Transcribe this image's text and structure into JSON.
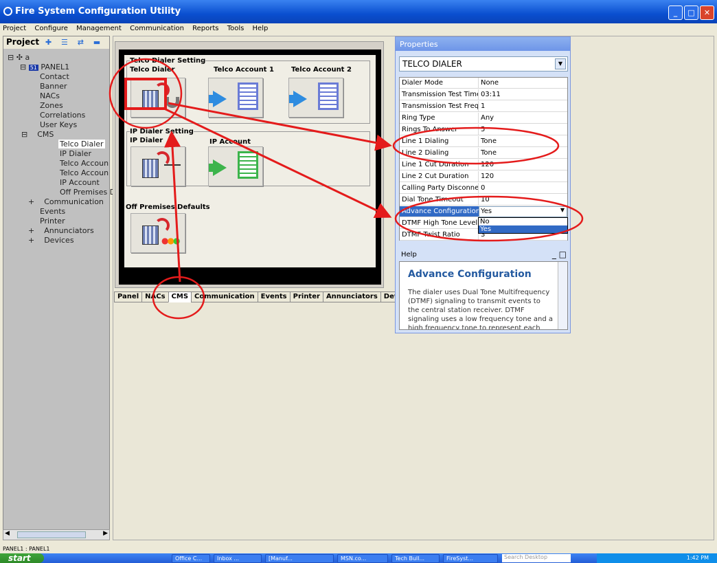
{
  "window": {
    "title": "Fire System Configuration Utility"
  },
  "menu": [
    "Project",
    "Configure",
    "Management",
    "Communication",
    "Reports",
    "Tools",
    "Help"
  ],
  "project": {
    "title": "Project",
    "tree": [
      "a",
      "PANEL1",
      "Contact",
      "Banner",
      "NACs",
      "Zones",
      "Correlations",
      "User Keys",
      "CMS",
      "Telco Dialer",
      "IP Dialer",
      "Telco Accoun",
      "Telco Accoun",
      "IP Account",
      "Off Premises D",
      "Communication",
      "Events",
      "Printer",
      "Annunciators",
      "Devices"
    ],
    "panel_badge": "51"
  },
  "cms": {
    "telco_group": "Telco Dialer Setting",
    "telco_dialer": "Telco Dialer",
    "telco_account1": "Telco Account 1",
    "telco_account2": "Telco Account 2",
    "ip_group": "IP Dialer Setting",
    "ip_dialer": "IP Dialer",
    "ip_account": "IP Account",
    "off_premises": "Off Premises Defaults"
  },
  "tabs": [
    "Panel",
    "NACs",
    "CMS",
    "Communication",
    "Events",
    "Printer",
    "Annunciators",
    "Devices"
  ],
  "properties": {
    "title": "Properties",
    "selected_object": "TELCO DIALER",
    "rows": [
      {
        "name": "Dialer Mode",
        "value": "None"
      },
      {
        "name": "Transmission Test Time",
        "value": "03:11"
      },
      {
        "name": "Transmission Test Frequenc",
        "value": "1"
      },
      {
        "name": "Ring Type",
        "value": "Any"
      },
      {
        "name": "Rings To Answer",
        "value": "5"
      },
      {
        "name": "Line 1 Dialing",
        "value": "Tone"
      },
      {
        "name": "Line 2 Dialing",
        "value": "Tone"
      },
      {
        "name": "Line 1 Cut Duration",
        "value": "120"
      },
      {
        "name": "Line 2 Cut Duration",
        "value": "120"
      },
      {
        "name": "Calling Party Disconnect",
        "value": "0"
      },
      {
        "name": "Dial Tone Timeout",
        "value": "10"
      },
      {
        "name": "Advance Configuration",
        "value": "Yes"
      },
      {
        "name": "DTMF High Tone Level",
        "value": ""
      },
      {
        "name": "DTMF Twist Ratio",
        "value": "3"
      }
    ],
    "dropdown_options": [
      "No",
      "Yes"
    ],
    "help_label": "Help",
    "help_title": "Advance Configuration",
    "help_text": "The dialer uses Dual Tone Multifrequency (DTMF) signaling to transmit events to the central station receiver. DTMF signaling uses a low frequency tone and a high frequency tone to represent each number transmitted"
  },
  "statusbar": {
    "text": "PANEL1 : PANEL1"
  },
  "taskbar": {
    "start": "start",
    "items": [
      "Office C...",
      "Inbox ...",
      "[Manuf...",
      "MSN.co...",
      "Tech Bull...",
      "FireSyst..."
    ],
    "search_placeholder": "Search Desktop",
    "clock": "1:42 PM"
  },
  "colors": {
    "annotation": "#e41b1b",
    "title_blue": "#0a4fd0",
    "selection": "#316ac5"
  }
}
